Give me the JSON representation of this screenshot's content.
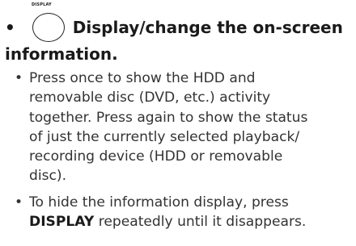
{
  "button_caption": "DISPLAY",
  "heading": {
    "bullet": "•",
    "line1": "Display/change the on-screen",
    "line2": "information."
  },
  "bullets": [
    {
      "marker": "•",
      "lines": [
        "Press once to show the HDD and",
        "removable disc (DVD, etc.) activity",
        "together. Press again to show the status",
        "of just the currently selected playback/",
        "recording device (HDD or removable",
        "disc)."
      ]
    },
    {
      "marker": "•",
      "lines": [
        "To hide the information display, press"
      ],
      "last_line_keyword": "DISPLAY",
      "last_line_rest": " repeatedly until it disappears."
    }
  ]
}
